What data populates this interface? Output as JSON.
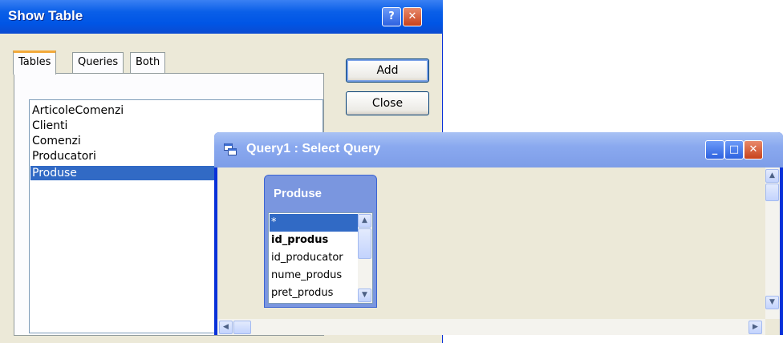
{
  "show_table": {
    "title": "Show Table",
    "help_glyph": "?",
    "close_glyph": "✕",
    "tabs": [
      {
        "label": "Tables",
        "active": true
      },
      {
        "label": "Queries",
        "active": false
      },
      {
        "label": "Both",
        "active": false
      }
    ],
    "tables": [
      "ArticoleComenzi",
      "Clienti",
      "Comenzi",
      "Producatori",
      "Produse"
    ],
    "selected_table": "Produse",
    "add_label": "Add",
    "close_label": "Close"
  },
  "query_window": {
    "title": "Query1 : Select Query",
    "minimize_glyph": "_",
    "maximize_glyph": "□",
    "close_glyph": "✕",
    "field_list": {
      "title": "Produse",
      "fields": [
        "*",
        "id_produs",
        "id_producator",
        "nume_produs",
        "pret_produs"
      ],
      "selected_field": "*",
      "primary_key_field": "id_produs"
    }
  },
  "colors": {
    "selection": "#316ac5",
    "titlebar_active": "#0055e5",
    "titlebar_inactive": "#8aa9ef",
    "window_background": "#ece9d8"
  }
}
